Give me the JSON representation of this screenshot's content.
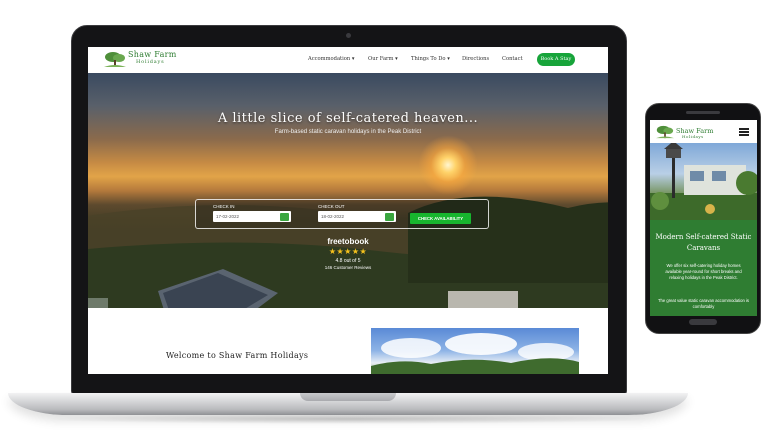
{
  "site": {
    "logo": {
      "name": "Shaw Farm",
      "sub": "Holidays"
    },
    "nav": {
      "items": [
        "Accommodation ▾",
        "Our Farm ▾",
        "Things To Do ▾",
        "Directions",
        "Contact"
      ],
      "book_label": "Book A Stay"
    },
    "hero": {
      "title": "A little slice of self-catered heaven...",
      "subtitle": "Farm-based static caravan holidays in the Peak District"
    },
    "search": {
      "checkin_label": "CHECK IN",
      "checkin_value": "17-02-2022",
      "checkout_label": "CHECK OUT",
      "checkout_value": "18-02-2022",
      "button_label": "CHECK AVAILABILITY"
    },
    "reviews": {
      "brand": "freetobook",
      "stars": "★★★★★",
      "rating": "4.8 out of 5",
      "count": "146 Customer Reviews"
    },
    "welcome": {
      "title": "Welcome to Shaw Farm Holidays"
    }
  },
  "mobile": {
    "logo": {
      "name": "Shaw Farm",
      "sub": "Holidays"
    },
    "title": "Modern Self-catered Static Caravans",
    "body1": "We offer six self-catering holiday homes available year-round for short breaks and relaxing holidays in the Peak District.",
    "body2": "The great value static caravan accommodation is comfortably"
  },
  "colors": {
    "brand_green": "#2f7d32",
    "button_green": "#17b52e",
    "star_gold": "#f6c21d"
  },
  "icons": [
    "tree-logo-icon",
    "calendar-icon",
    "hamburger-menu-icon",
    "star-icon"
  ]
}
